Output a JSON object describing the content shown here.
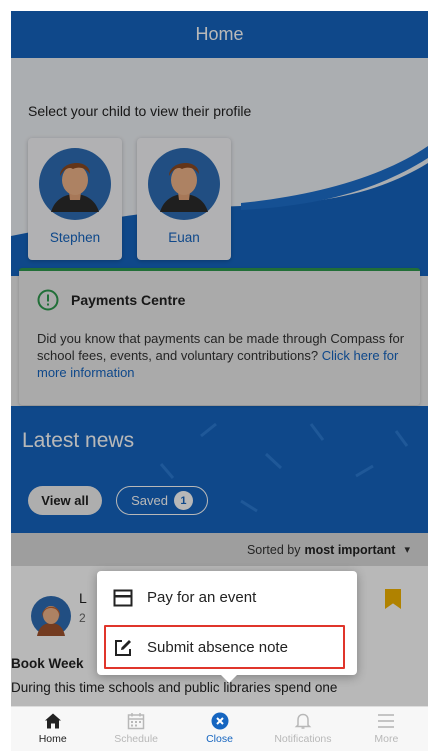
{
  "header": {
    "title": "Home"
  },
  "profile": {
    "prompt": "Select your child to view their profile",
    "children": [
      {
        "name": "Stephen"
      },
      {
        "name": "Euan"
      }
    ]
  },
  "payments": {
    "title": "Payments Centre",
    "body": "Did you know that payments can be made through Compass for school fees, events, and voluntary contributions?",
    "link": "Click here for more information",
    "icon": "alert-circle-icon",
    "accent": "#2e9a4e"
  },
  "news": {
    "title": "Latest news",
    "view_all": "View all",
    "saved_label": "Saved",
    "saved_count": "1"
  },
  "sort": {
    "prefix": "Sorted by",
    "value": "most important",
    "arrow": "▾"
  },
  "article": {
    "author_initial": "L",
    "date_initial": "2",
    "title": "Book Week",
    "text": "During this time schools and public libraries spend one"
  },
  "popup": {
    "items": [
      {
        "label": "Pay for an event",
        "icon": "card-icon"
      },
      {
        "label": "Submit absence note",
        "icon": "edit-note-icon",
        "highlighted": true
      }
    ],
    "highlight_color": "#e0352b"
  },
  "tabbar": {
    "tabs": [
      {
        "label": "Home",
        "icon": "home-icon",
        "state": "active"
      },
      {
        "label": "Schedule",
        "icon": "calendar-icon",
        "state": "muted"
      },
      {
        "label": "Close",
        "icon": "close-circle-icon",
        "state": "accent"
      },
      {
        "label": "Notifications",
        "icon": "bell-icon",
        "state": "muted"
      },
      {
        "label": "More",
        "icon": "menu-icon",
        "state": "muted"
      }
    ]
  },
  "colors": {
    "brand": "#1565c0",
    "bookmark": "#f4b400"
  }
}
